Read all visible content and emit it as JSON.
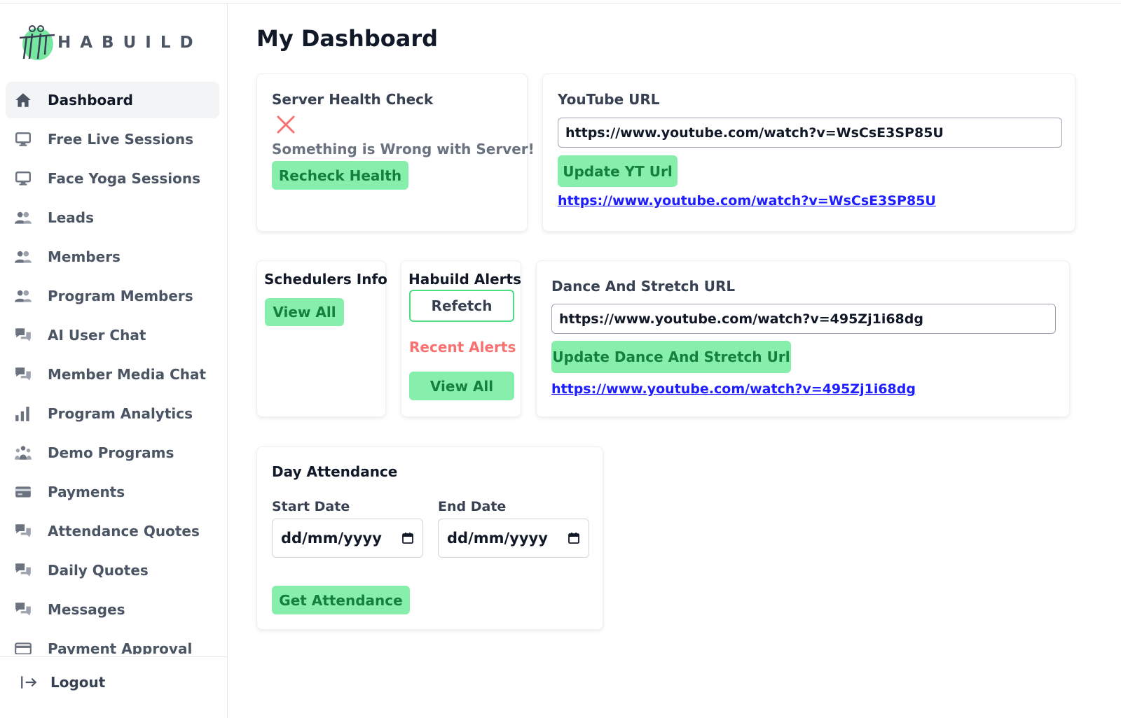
{
  "brand": {
    "logo_text": "HABUILD",
    "accent": "#4ade80",
    "button_bg": "#86efac",
    "button_text": "#15803d"
  },
  "sidebar": {
    "items": [
      {
        "label": "Dashboard",
        "icon": "home-icon",
        "active": true
      },
      {
        "label": "Free Live Sessions",
        "icon": "monitor-icon"
      },
      {
        "label": "Face Yoga Sessions",
        "icon": "monitor-icon"
      },
      {
        "label": "Leads",
        "icon": "users-icon"
      },
      {
        "label": "Members",
        "icon": "users-icon"
      },
      {
        "label": "Program Members",
        "icon": "users-icon"
      },
      {
        "label": "AI User Chat",
        "icon": "chat-icon"
      },
      {
        "label": "Member Media Chat",
        "icon": "chat-icon"
      },
      {
        "label": "Program Analytics",
        "icon": "bar-chart-icon"
      },
      {
        "label": "Demo Programs",
        "icon": "group-icon"
      },
      {
        "label": "Payments",
        "icon": "credit-card-icon"
      },
      {
        "label": "Attendance Quotes",
        "icon": "chat-icon"
      },
      {
        "label": "Daily Quotes",
        "icon": "chat-icon"
      },
      {
        "label": "Messages",
        "icon": "chat-icon"
      },
      {
        "label": "Payment Approval",
        "icon": "card-check-icon"
      }
    ],
    "logout_label": "Logout"
  },
  "main": {
    "title": "My Dashboard",
    "server_health": {
      "title": "Server Health Check",
      "status_icon": "close-icon",
      "status_text": "Something is Wrong with Server!",
      "recheck_label": "Recheck Health"
    },
    "youtube": {
      "title": "YouTube URL",
      "input_value": "https://www.youtube.com/watch?v=WsCsE3SP85U",
      "update_label": "Update YT Url",
      "link_text": "https://www.youtube.com/watch?v=WsCsE3SP85U"
    },
    "schedulers": {
      "title": "Schedulers Info",
      "view_all_label": "View All"
    },
    "alerts": {
      "title": "Habuild Alerts",
      "refetch_label": "Refetch",
      "recent_label": "Recent Alerts",
      "view_all_label": "View All"
    },
    "dance_stretch": {
      "title": "Dance And Stretch URL",
      "input_value": "https://www.youtube.com/watch?v=495Zj1i68dg",
      "update_label": "Update Dance And Stretch Url",
      "link_text": "https://www.youtube.com/watch?v=495Zj1i68dg"
    },
    "attendance": {
      "title": "Day Attendance",
      "start_label": "Start Date",
      "start_placeholder": "dd/mm/yyyy",
      "end_label": "End Date",
      "end_placeholder": "dd/mm/yyyy",
      "get_label": "Get Attendance"
    }
  }
}
